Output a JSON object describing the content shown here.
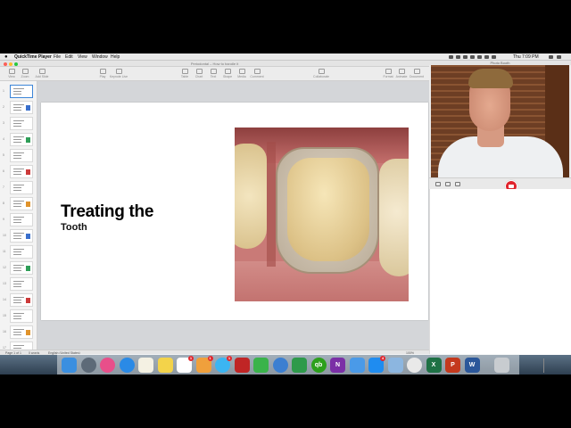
{
  "menubar": {
    "apple": "",
    "app_name": "QuickTime Player",
    "items": [
      "File",
      "Edit",
      "View",
      "Window",
      "Help"
    ],
    "clock": "Thu 7:09 PM"
  },
  "keynote": {
    "window_title": "Periodontal – How to handle it",
    "toolbar": [
      {
        "label": "View",
        "icon": "view-icon"
      },
      {
        "label": "Zoom",
        "icon": "zoom-icon"
      },
      {
        "label": "Add Slide",
        "icon": "add-slide-icon"
      },
      {
        "label": "Play",
        "icon": "play-icon"
      },
      {
        "label": "Keynote Live",
        "icon": "keynote-live-icon"
      },
      {
        "label": "Table",
        "icon": "table-icon"
      },
      {
        "label": "Chart",
        "icon": "chart-icon"
      },
      {
        "label": "Text",
        "icon": "text-icon"
      },
      {
        "label": "Shape",
        "icon": "shape-icon"
      },
      {
        "label": "Media",
        "icon": "media-icon"
      },
      {
        "label": "Comment",
        "icon": "comment-icon"
      },
      {
        "label": "Collaborate",
        "icon": "collaborate-icon"
      },
      {
        "label": "Format",
        "icon": "format-icon"
      },
      {
        "label": "Animate",
        "icon": "animate-icon"
      },
      {
        "label": "Document",
        "icon": "document-icon"
      }
    ],
    "slide_numbers": [
      "1",
      "2",
      "3",
      "4",
      "5",
      "6",
      "7",
      "8",
      "9",
      "10",
      "11",
      "12",
      "13",
      "14",
      "15",
      "16",
      "17"
    ],
    "slide": {
      "title": "Treating the",
      "subtitle": "Tooth",
      "image": "tooth-crown-photo"
    },
    "status": {
      "left": "Page 1 of 1",
      "words": "0 words",
      "language": "English (United States)",
      "zoom": "100%"
    }
  },
  "photobooth": {
    "title": "Photo Booth",
    "webcam": "webcam-feed",
    "shutter_icon": "camera-icon"
  },
  "dock": {
    "apps": [
      {
        "name": "finder-icon",
        "color": "#3b8fe0",
        "badge": ""
      },
      {
        "name": "launchpad-icon",
        "color": "#5d6a78",
        "badge": ""
      },
      {
        "name": "itunes-icon",
        "color": "#e84f8a",
        "badge": ""
      },
      {
        "name": "safari-icon",
        "color": "#2a8ae6",
        "badge": ""
      },
      {
        "name": "notes-icon",
        "color": "#f4f1e3",
        "badge": ""
      },
      {
        "name": "stickies-icon",
        "color": "#f3d34a",
        "badge": ""
      },
      {
        "name": "reminders-icon",
        "color": "#ffffff",
        "badge": "1"
      },
      {
        "name": "photos-icon",
        "color": "#f0a03c",
        "badge": "1"
      },
      {
        "name": "messages-icon",
        "color": "#3bb5f2",
        "badge": "1"
      },
      {
        "name": "photo-booth-icon",
        "color": "#c02525",
        "badge": ""
      },
      {
        "name": "facetime-icon",
        "color": "#3ab34a",
        "badge": ""
      },
      {
        "name": "tweetbot-icon",
        "color": "#3c7fd1",
        "badge": ""
      },
      {
        "name": "camtasia-icon",
        "color": "#2e9a4a",
        "badge": ""
      },
      {
        "name": "quickbooks-icon",
        "color": "#2ca01c",
        "badge": ""
      },
      {
        "name": "onenote-icon",
        "color": "#7b2fa6",
        "badge": ""
      },
      {
        "name": "icloud-icon",
        "color": "#4a9ae8",
        "badge": ""
      },
      {
        "name": "app-store-icon",
        "color": "#1f8cf0",
        "badge": "4"
      },
      {
        "name": "preview-icon",
        "color": "#8cb6e0",
        "badge": ""
      },
      {
        "name": "chrome-icon",
        "color": "#e9e9e9",
        "badge": ""
      },
      {
        "name": "excel-icon",
        "color": "#1e7145",
        "badge": ""
      },
      {
        "name": "powerpoint-icon",
        "color": "#c4391d",
        "badge": ""
      },
      {
        "name": "word-icon",
        "color": "#2b579a",
        "badge": ""
      },
      {
        "name": "trash-icon",
        "color": "#c8ccd0",
        "badge": ""
      }
    ],
    "letters": {
      "quickbooks-icon": "qb",
      "onenote-icon": "N",
      "excel-icon": "X",
      "powerpoint-icon": "P",
      "word-icon": "W"
    }
  }
}
